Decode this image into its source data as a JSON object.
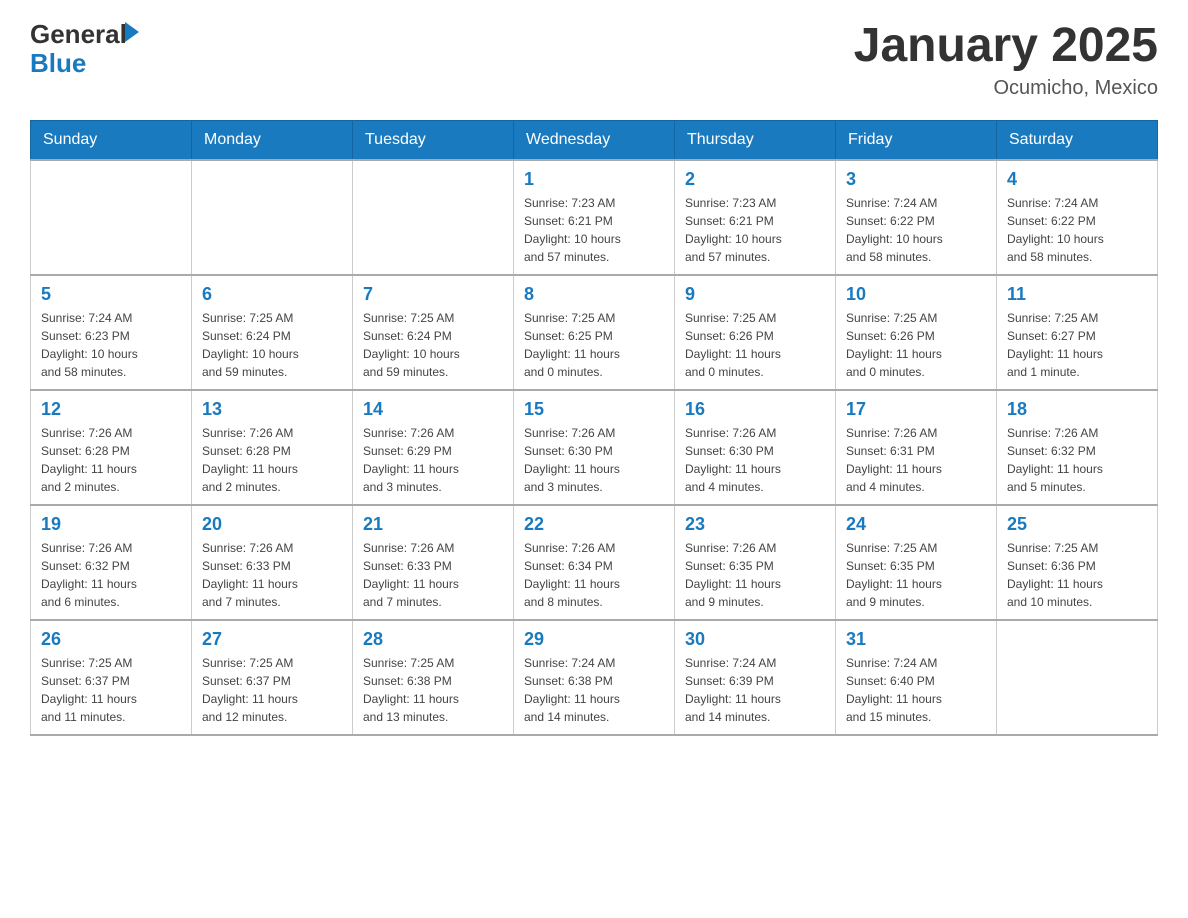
{
  "header": {
    "logo_general": "General",
    "logo_blue": "Blue",
    "title": "January 2025",
    "subtitle": "Ocumicho, Mexico"
  },
  "weekdays": [
    "Sunday",
    "Monday",
    "Tuesday",
    "Wednesday",
    "Thursday",
    "Friday",
    "Saturday"
  ],
  "weeks": [
    [
      {
        "day": "",
        "info": ""
      },
      {
        "day": "",
        "info": ""
      },
      {
        "day": "",
        "info": ""
      },
      {
        "day": "1",
        "info": "Sunrise: 7:23 AM\nSunset: 6:21 PM\nDaylight: 10 hours\nand 57 minutes."
      },
      {
        "day": "2",
        "info": "Sunrise: 7:23 AM\nSunset: 6:21 PM\nDaylight: 10 hours\nand 57 minutes."
      },
      {
        "day": "3",
        "info": "Sunrise: 7:24 AM\nSunset: 6:22 PM\nDaylight: 10 hours\nand 58 minutes."
      },
      {
        "day": "4",
        "info": "Sunrise: 7:24 AM\nSunset: 6:22 PM\nDaylight: 10 hours\nand 58 minutes."
      }
    ],
    [
      {
        "day": "5",
        "info": "Sunrise: 7:24 AM\nSunset: 6:23 PM\nDaylight: 10 hours\nand 58 minutes."
      },
      {
        "day": "6",
        "info": "Sunrise: 7:25 AM\nSunset: 6:24 PM\nDaylight: 10 hours\nand 59 minutes."
      },
      {
        "day": "7",
        "info": "Sunrise: 7:25 AM\nSunset: 6:24 PM\nDaylight: 10 hours\nand 59 minutes."
      },
      {
        "day": "8",
        "info": "Sunrise: 7:25 AM\nSunset: 6:25 PM\nDaylight: 11 hours\nand 0 minutes."
      },
      {
        "day": "9",
        "info": "Sunrise: 7:25 AM\nSunset: 6:26 PM\nDaylight: 11 hours\nand 0 minutes."
      },
      {
        "day": "10",
        "info": "Sunrise: 7:25 AM\nSunset: 6:26 PM\nDaylight: 11 hours\nand 0 minutes."
      },
      {
        "day": "11",
        "info": "Sunrise: 7:25 AM\nSunset: 6:27 PM\nDaylight: 11 hours\nand 1 minute."
      }
    ],
    [
      {
        "day": "12",
        "info": "Sunrise: 7:26 AM\nSunset: 6:28 PM\nDaylight: 11 hours\nand 2 minutes."
      },
      {
        "day": "13",
        "info": "Sunrise: 7:26 AM\nSunset: 6:28 PM\nDaylight: 11 hours\nand 2 minutes."
      },
      {
        "day": "14",
        "info": "Sunrise: 7:26 AM\nSunset: 6:29 PM\nDaylight: 11 hours\nand 3 minutes."
      },
      {
        "day": "15",
        "info": "Sunrise: 7:26 AM\nSunset: 6:30 PM\nDaylight: 11 hours\nand 3 minutes."
      },
      {
        "day": "16",
        "info": "Sunrise: 7:26 AM\nSunset: 6:30 PM\nDaylight: 11 hours\nand 4 minutes."
      },
      {
        "day": "17",
        "info": "Sunrise: 7:26 AM\nSunset: 6:31 PM\nDaylight: 11 hours\nand 4 minutes."
      },
      {
        "day": "18",
        "info": "Sunrise: 7:26 AM\nSunset: 6:32 PM\nDaylight: 11 hours\nand 5 minutes."
      }
    ],
    [
      {
        "day": "19",
        "info": "Sunrise: 7:26 AM\nSunset: 6:32 PM\nDaylight: 11 hours\nand 6 minutes."
      },
      {
        "day": "20",
        "info": "Sunrise: 7:26 AM\nSunset: 6:33 PM\nDaylight: 11 hours\nand 7 minutes."
      },
      {
        "day": "21",
        "info": "Sunrise: 7:26 AM\nSunset: 6:33 PM\nDaylight: 11 hours\nand 7 minutes."
      },
      {
        "day": "22",
        "info": "Sunrise: 7:26 AM\nSunset: 6:34 PM\nDaylight: 11 hours\nand 8 minutes."
      },
      {
        "day": "23",
        "info": "Sunrise: 7:26 AM\nSunset: 6:35 PM\nDaylight: 11 hours\nand 9 minutes."
      },
      {
        "day": "24",
        "info": "Sunrise: 7:25 AM\nSunset: 6:35 PM\nDaylight: 11 hours\nand 9 minutes."
      },
      {
        "day": "25",
        "info": "Sunrise: 7:25 AM\nSunset: 6:36 PM\nDaylight: 11 hours\nand 10 minutes."
      }
    ],
    [
      {
        "day": "26",
        "info": "Sunrise: 7:25 AM\nSunset: 6:37 PM\nDaylight: 11 hours\nand 11 minutes."
      },
      {
        "day": "27",
        "info": "Sunrise: 7:25 AM\nSunset: 6:37 PM\nDaylight: 11 hours\nand 12 minutes."
      },
      {
        "day": "28",
        "info": "Sunrise: 7:25 AM\nSunset: 6:38 PM\nDaylight: 11 hours\nand 13 minutes."
      },
      {
        "day": "29",
        "info": "Sunrise: 7:24 AM\nSunset: 6:38 PM\nDaylight: 11 hours\nand 14 minutes."
      },
      {
        "day": "30",
        "info": "Sunrise: 7:24 AM\nSunset: 6:39 PM\nDaylight: 11 hours\nand 14 minutes."
      },
      {
        "day": "31",
        "info": "Sunrise: 7:24 AM\nSunset: 6:40 PM\nDaylight: 11 hours\nand 15 minutes."
      },
      {
        "day": "",
        "info": ""
      }
    ]
  ]
}
